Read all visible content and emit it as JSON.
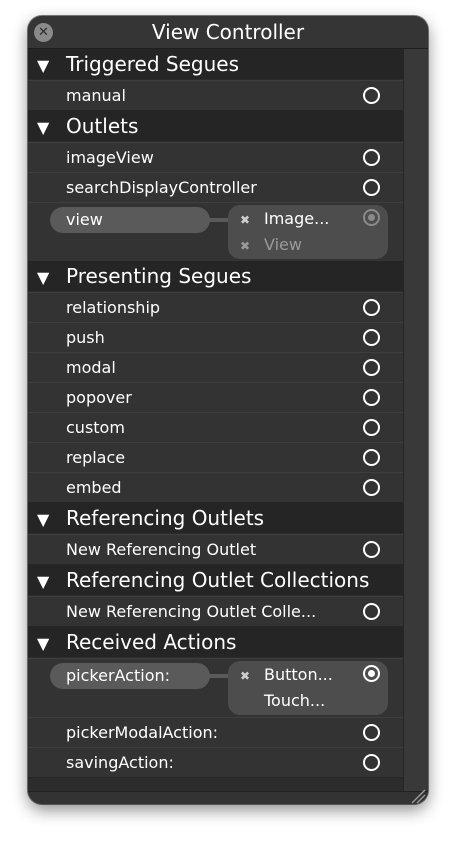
{
  "window": {
    "title": "View Controller",
    "close_icon": "close-icon"
  },
  "sections": {
    "triggered_segues": {
      "title": "Triggered Segues",
      "rows": [
        "manual"
      ]
    },
    "outlets": {
      "title": "Outlets",
      "rows": [
        "imageView",
        "searchDisplayController"
      ],
      "connected": {
        "label": "view",
        "targets": [
          "Image...",
          "View"
        ]
      }
    },
    "presenting_segues": {
      "title": "Presenting Segues",
      "rows": [
        "relationship",
        "push",
        "modal",
        "popover",
        "custom",
        "replace",
        "embed"
      ]
    },
    "referencing_outlets": {
      "title": "Referencing Outlets",
      "rows": [
        "New Referencing Outlet"
      ]
    },
    "referencing_outlet_collections": {
      "title": "Referencing Outlet Collections",
      "rows": [
        "New Referencing Outlet Colle..."
      ]
    },
    "received_actions": {
      "title": "Received Actions",
      "connected": {
        "label": "pickerAction:",
        "targets": [
          "Button...",
          "Touch..."
        ]
      },
      "rows": [
        "pickerModalAction:",
        "savingAction:"
      ]
    }
  },
  "icons": {
    "disclosure": "disclosure-triangle-icon",
    "connection": "connection-circle-icon",
    "remove": "remove-connection-icon",
    "resize": "resize-grip-icon"
  },
  "colors": {
    "panel_bg": "#2c2c2c",
    "header_bg": "#252525",
    "row_bg": "#333333",
    "pill_bg": "#5a5a5a",
    "text": "#ffffff"
  }
}
